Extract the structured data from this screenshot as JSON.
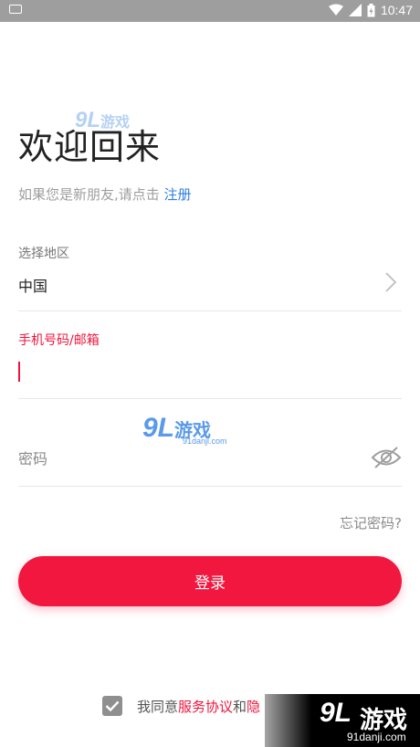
{
  "status_bar": {
    "time": "10:47"
  },
  "login": {
    "title": "欢迎回来",
    "subtitle_prefix": "如果您是新朋友,请点击 ",
    "register_link": "注册",
    "region_label": "选择地区",
    "region_value": "中国",
    "phone_label": "手机号码/邮箱",
    "phone_value": "",
    "password_placeholder": "密码",
    "forgot_password": "忘记密码?",
    "login_button": "登录",
    "agreement_prefix": "我同意",
    "agreement_service": "服务协议",
    "agreement_and": "和",
    "agreement_privacy_partial": "隐"
  },
  "watermark": {
    "logo": "9L",
    "text": "游戏",
    "site": "91danji.com"
  },
  "colors": {
    "accent": "#f2173f",
    "link": "#2f7fe0",
    "status_bar": "#9e9e9e"
  }
}
